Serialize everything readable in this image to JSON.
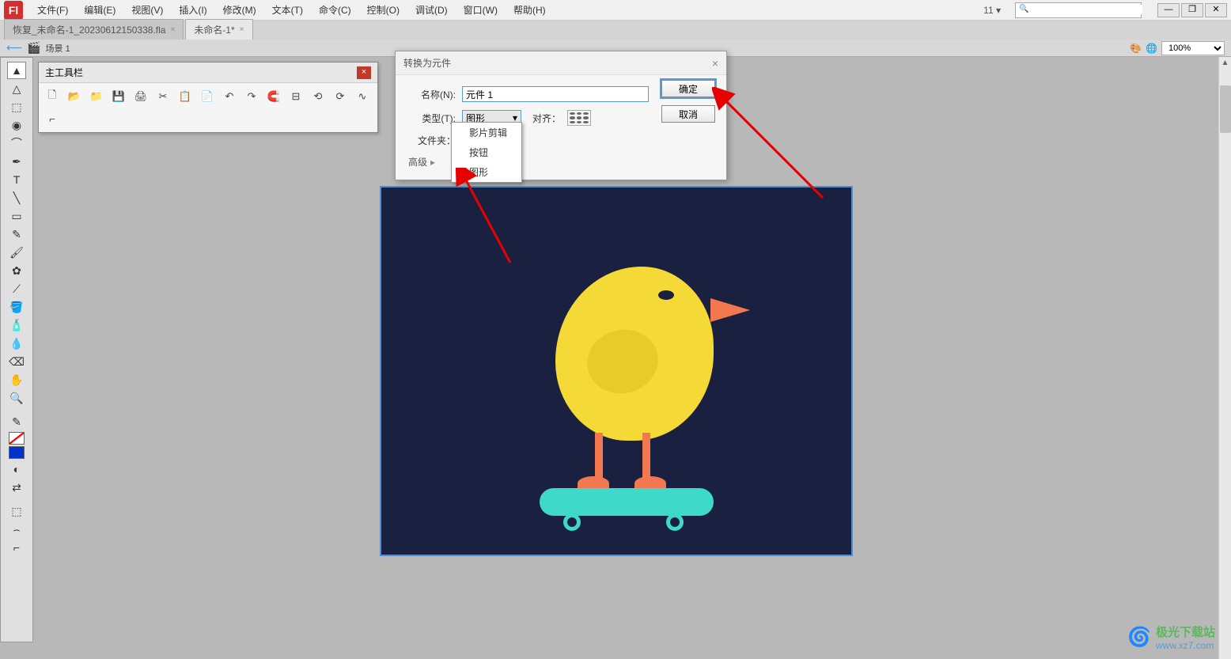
{
  "menubar": {
    "items": [
      "文件(F)",
      "编辑(E)",
      "视图(V)",
      "插入(I)",
      "修改(M)",
      "文本(T)",
      "命令(C)",
      "控制(O)",
      "调试(D)",
      "窗口(W)",
      "帮助(H)"
    ],
    "font_size": "11",
    "search_placeholder": ""
  },
  "window_controls": {
    "min": "—",
    "max": "❐",
    "close": "✕"
  },
  "doc_tabs": [
    {
      "label": "恢复_未命名-1_20230612150338.fla",
      "active": false
    },
    {
      "label": "未命名-1*",
      "active": true
    }
  ],
  "scene_bar": {
    "back": "⟵",
    "label": "场景 1",
    "zoom": "100%"
  },
  "tools": {
    "items": [
      "selection",
      "subselection",
      "free-transform",
      "3d-rotation",
      "lasso",
      "pen",
      "text",
      "line",
      "rectangle",
      "pencil",
      "brush",
      "deco",
      "bone",
      "paint-bucket",
      "ink-bottle",
      "eyedropper",
      "eraser",
      "hand",
      "zoom"
    ],
    "bottom": [
      "stroke-color",
      "swap",
      "fill-color",
      "bw",
      "no-color",
      "swap2"
    ]
  },
  "main_toolbar": {
    "title": "主工具栏",
    "buttons": [
      "new",
      "open",
      "save-as",
      "save",
      "print",
      "cut",
      "copy",
      "paste",
      "undo",
      "redo",
      "magnet",
      "align",
      "rotate-ccw",
      "rotate-cw",
      "smooth",
      "straighten"
    ]
  },
  "dialog": {
    "title": "转换为元件",
    "name_label": "名称(N):",
    "name_value": "元件 1",
    "type_label": "类型(T):",
    "type_value": "图形",
    "align_label": "对齐：",
    "folder_label": "文件夹：",
    "advanced_label": "高级",
    "ok": "确定",
    "cancel": "取消",
    "dropdown_options": [
      "影片剪辑",
      "按钮",
      "图形"
    ]
  },
  "watermark": {
    "cn": "极光下载站",
    "url": "www.xz7.com"
  }
}
